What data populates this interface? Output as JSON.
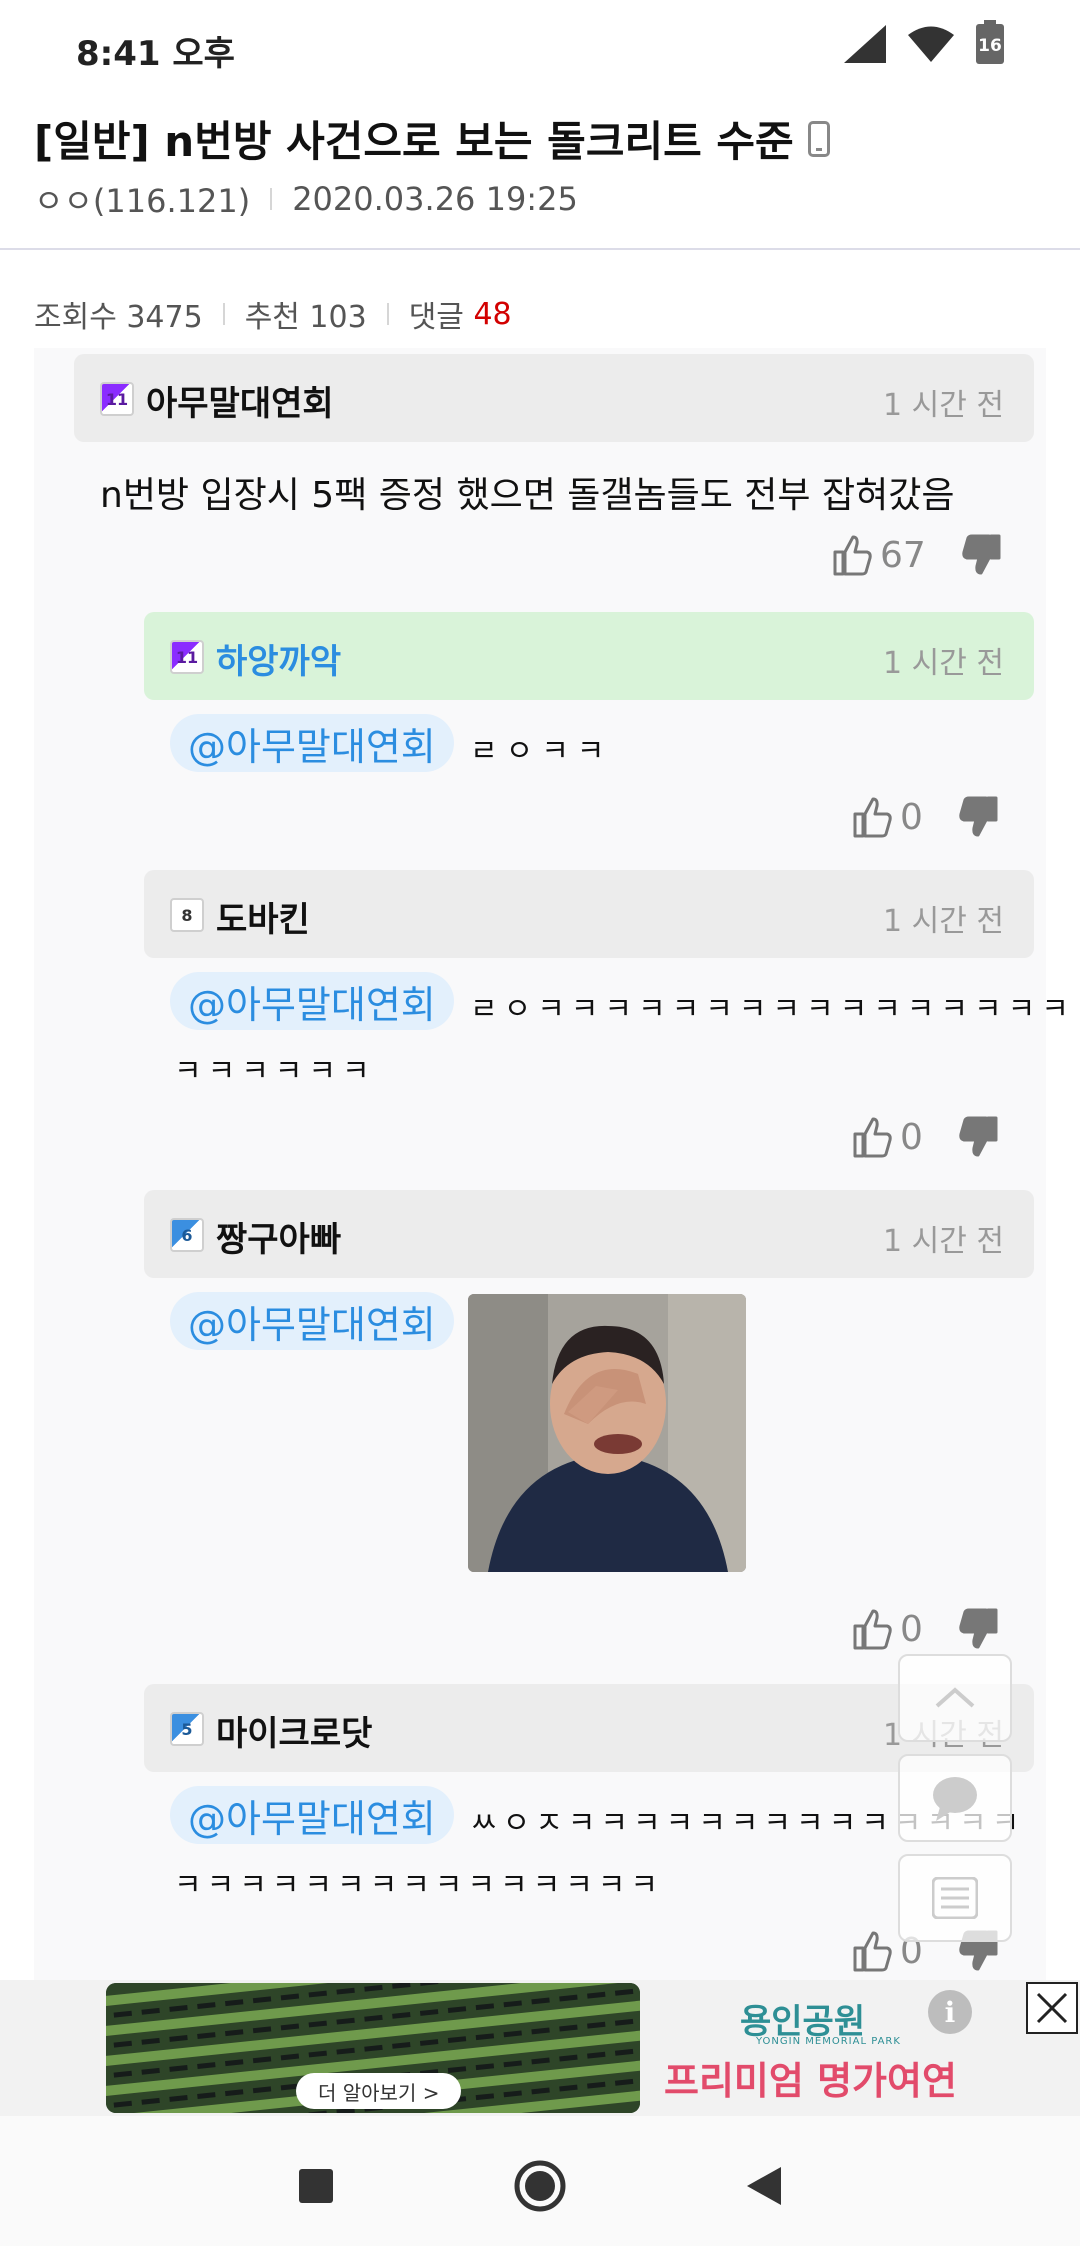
{
  "status_bar": {
    "time": "8:41 오후",
    "battery": "16"
  },
  "post": {
    "title": "[일반] n번방 사건으로 보는 돌크리트 수준",
    "author": "ㅇㅇ(116.121)",
    "date": "2020.03.26 19:25"
  },
  "stats": {
    "views_label": "조회수 3475",
    "recommend_label": "추천 103",
    "comments_label": "댓글",
    "comments_count": "48"
  },
  "comments": [
    {
      "nick": "아무말대연회",
      "time": "1 시간 전",
      "level": "11",
      "text": "n번방 입장시 5팩 증정 했으면 돌갤놈들도 전부 잡혀갔음",
      "likes": "67"
    },
    {
      "nick": "하앙까악",
      "time": "1 시간 전",
      "level": "11",
      "mention": "@아무말대연회",
      "text": "ㄹㅇㅋㅋ",
      "likes": "0"
    },
    {
      "nick": "도바킨",
      "time": "1 시간 전",
      "level": "8",
      "mention": "@아무말대연회",
      "text_line1": "ㄹㅇㅋㅋㅋㅋㅋㅋㅋㅋㅋㅋㅋㅋㅋㅋㅋㅋ",
      "text_line2": "ㅋㅋㅋㅋㅋㅋ",
      "likes": "0"
    },
    {
      "nick": "짱구아빠",
      "time": "1 시간 전",
      "level": "6",
      "mention": "@아무말대연회",
      "likes": "0"
    },
    {
      "nick": "마이크로닷",
      "time": "1 시간 전",
      "level": "5",
      "mention": "@아무말대연회",
      "text_line1": "ㅆㅇㅈㅋㅋㅋㅋㅋㅋㅋㅋㅋㅋㅋㅋㅋㅋ",
      "text_line2": "ㅋㅋㅋㅋㅋㅋㅋㅋㅋㅋㅋㅋㅋㅋㅋ",
      "likes": "0"
    }
  ],
  "ad": {
    "more_label": "더 알아보기 >",
    "brand": "용인공원",
    "brand_sub": "YONGIN MEMORIAL PARK",
    "tagline": "프리미엄 명가여연",
    "info": "i"
  },
  "icons": {
    "signal": "signal-icon",
    "wifi": "wifi-icon",
    "battery": "battery-icon",
    "thumb_up": "thumb-up-icon",
    "thumb_down": "thumb-down-icon",
    "scroll_top": "chevron-up-icon",
    "comment": "comment-bubble-icon",
    "list": "list-icon",
    "close": "close-icon",
    "nav_recent": "square-icon",
    "nav_home": "circle-icon",
    "nav_back": "triangle-back-icon"
  },
  "colors": {
    "accent_blue": "#2b8de0",
    "comment_count_red": "#d20000",
    "reply_highlight": "#d9f3d9",
    "ad_tagline": "#e24b6b"
  }
}
